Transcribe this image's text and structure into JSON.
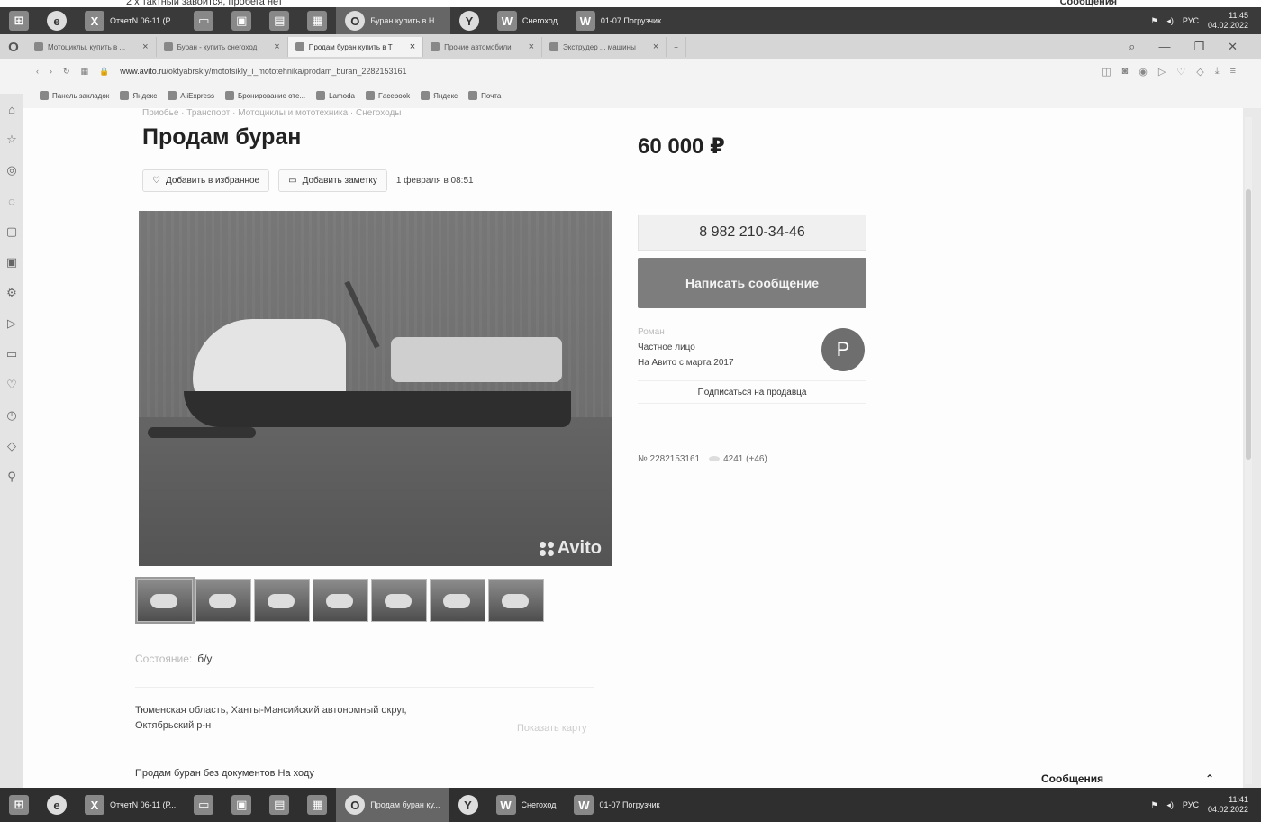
{
  "top_strip": {
    "ghost_text": "2 х тактный завоится, пробега нет",
    "messages_label": "Сообщения"
  },
  "taskbar_top": {
    "items": [
      "ОтчетN 06-11 (Р...",
      "Буран купить в Н...",
      "Снегоход",
      "01-07 Погрузчик"
    ]
  },
  "tabs": [
    "Мотоциклы, купить в ...",
    "Буран - купить снегоход",
    "Продам буран купить в Т",
    "Прочие автомобили",
    "Экструдер ... машины"
  ],
  "address": {
    "domain": "www.avito.ru",
    "path": "/oktyabrskiy/mototsikly_i_mototehnika/prodam_buran_2282153161"
  },
  "bookmarks": [
    "Панель закладок",
    "Яндекс",
    "AliExpress",
    "Бронирование оте...",
    "Lamoda",
    "Facebook",
    "Яндекс",
    "Почта"
  ],
  "listing": {
    "breadcrumb": "Приобье · Транспорт · Мотоциклы и мототехника · Снегоходы",
    "title": "Продам буран",
    "price": "60 000 ₽",
    "add_favorite": "Добавить в избранное",
    "add_note": "Добавить заметку",
    "date": "1 февраля в 08:51",
    "watermark": "Avito",
    "thumbnail_count": 7,
    "condition_key": "Состояние:",
    "condition_value": "б/у",
    "address_line1": "Тюменская область, Ханты-Мансийский автономный округ,",
    "address_line2": "Октябрьский р-н",
    "show_map": "Показать карту",
    "description": "Продам буран без документов На ходу"
  },
  "seller": {
    "phone": "8 982 210-34-46",
    "write_message": "Написать сообщение",
    "name": "Роман",
    "type": "Частное лицо",
    "since": "На Авито с марта 2017",
    "avatar_letter": "Р",
    "subscribe": "Подписаться на продавца",
    "ad_number": "№ 2282153161",
    "views": "4241 (+46)"
  },
  "messages_panel": {
    "label": "Сообщения"
  },
  "taskbar_bottom": {
    "items": [
      "ОтчетN 06-11 (Р...",
      "Продам буран ку...",
      "Снегоход",
      "01-07 Погрузчик"
    ],
    "lang": "РУС",
    "time": "11:41",
    "date": "04.02.2022"
  },
  "taskbar_top_clock": {
    "time": "11:45",
    "date": "04.02.2022"
  }
}
